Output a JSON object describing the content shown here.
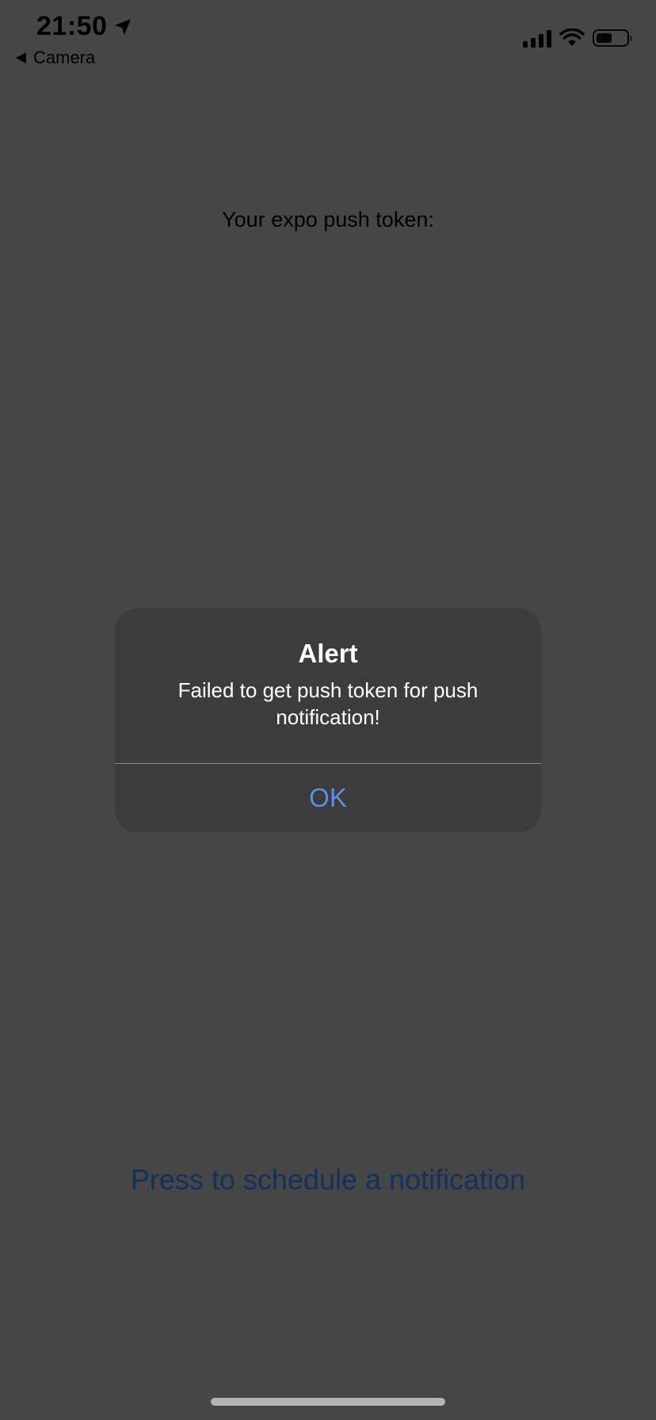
{
  "status_bar": {
    "time": "21:50",
    "back_app": "Camera",
    "battery_level": 0.52,
    "icons": [
      "location-arrow-icon",
      "cellular-signal-icon",
      "wifi-icon",
      "battery-icon"
    ]
  },
  "main": {
    "token_label": "Your expo push token:",
    "schedule_button": "Press to schedule a notification"
  },
  "alert": {
    "title": "Alert",
    "message": "Failed to get push token for push notification!",
    "ok_label": "OK"
  },
  "colors": {
    "dimmed_background": "#464646",
    "alert_background": "#3c3c3c",
    "alert_button": "#5d8fe8",
    "link_dimmed": "#12315f"
  }
}
